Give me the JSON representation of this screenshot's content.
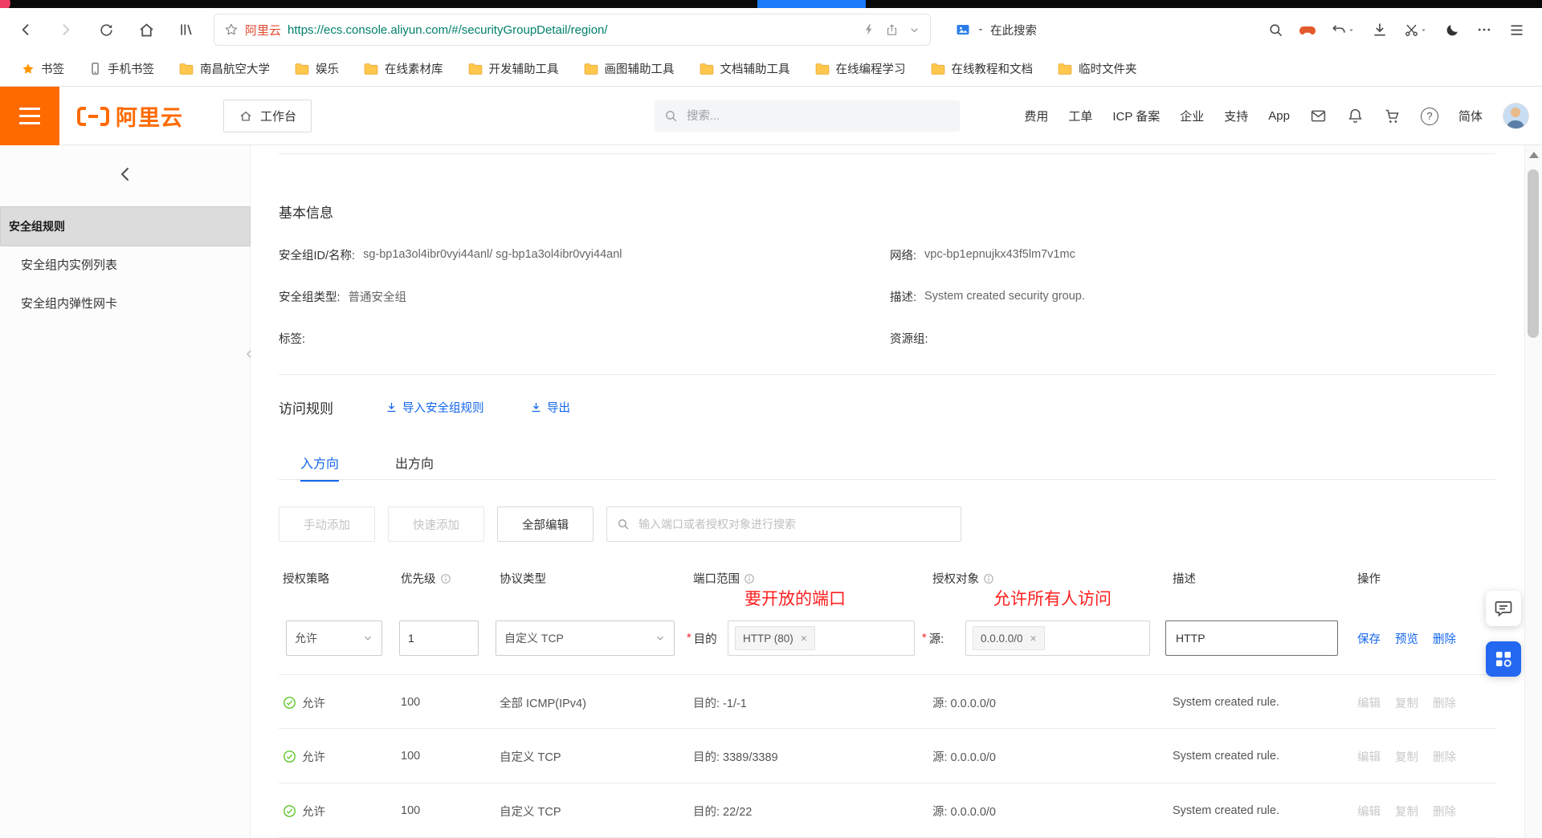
{
  "colors": {
    "brand_orange": "#ff6a00",
    "link_blue": "#1366ec",
    "url_teal": "#00806a",
    "annotation_red": "#ff1f1f",
    "success_green": "#52c41a",
    "float_button_blue": "#2468f2"
  },
  "browser": {
    "site_label": "阿里云",
    "url": "https://ecs.console.aliyun.com/#/securityGroupDetail/region/",
    "search_here": "在此搜索",
    "bookmarks": [
      {
        "label": "书签"
      },
      {
        "label": "手机书签"
      },
      {
        "label": "南昌航空大学"
      },
      {
        "label": "娱乐"
      },
      {
        "label": "在线素材库"
      },
      {
        "label": "开发辅助工具"
      },
      {
        "label": "画图辅助工具"
      },
      {
        "label": "文档辅助工具"
      },
      {
        "label": "在线编程学习"
      },
      {
        "label": "在线教程和文档"
      },
      {
        "label": "临时文件夹"
      }
    ]
  },
  "console": {
    "logo": "阿里云",
    "workbench": "工作台",
    "search_placeholder": "搜索...",
    "menu": [
      "费用",
      "工单",
      "ICP 备案",
      "企业",
      "支持",
      "App"
    ],
    "lang": "简体"
  },
  "sidebar": {
    "items": [
      "安全组规则",
      "安全组内实例列表",
      "安全组内弹性网卡"
    ]
  },
  "basic": {
    "title": "基本信息",
    "id_label": "安全组ID/名称:",
    "id_value": "sg-bp1a3ol4ibr0vyi44anl/ sg-bp1a3ol4ibr0vyi44anl",
    "network_label": "网络:",
    "network_value": "vpc-bp1epnujkx43f5lm7v1mc",
    "type_label": "安全组类型:",
    "type_value": "普通安全组",
    "desc_label": "描述:",
    "desc_value": "System created security group.",
    "tag_label": "标签:",
    "resource_label": "资源组:"
  },
  "rules": {
    "title": "访问规则",
    "import": "导入安全组规则",
    "export": "导出",
    "tab_in": "入方向",
    "tab_out": "出方向",
    "btn_manual": "手动添加",
    "btn_quick": "快速添加",
    "btn_edit_all": "全部编辑",
    "search_placeholder": "输入端口或者授权对象进行搜索",
    "headers": {
      "policy": "授权策略",
      "priority": "优先级",
      "protocol": "协议类型",
      "port": "端口范围",
      "target": "授权对象",
      "desc": "描述",
      "ops": "操作"
    },
    "annotation_port": "要开放的端口",
    "annotation_access": "允许所有人访问",
    "edit": {
      "required_mark": "*",
      "policy": "允许",
      "priority": "1",
      "protocol": "自定义 TCP",
      "dest_label": "目的",
      "port_chip": "HTTP (80)",
      "remove": "×",
      "src_label": "源:",
      "src_chip": "0.0.0.0/0",
      "desc_value": "HTTP",
      "save": "保存",
      "preview": "预览",
      "delete": "删除"
    },
    "rows": [
      {
        "policy": "允许",
        "priority": "100",
        "protocol": "全部 ICMP(IPv4)",
        "port": "目的: -1/-1",
        "source": "源: 0.0.0.0/0",
        "desc": "System created rule.",
        "op1": "编辑",
        "op2": "复制",
        "op3": "删除"
      },
      {
        "policy": "允许",
        "priority": "100",
        "protocol": "自定义 TCP",
        "port": "目的: 3389/3389",
        "source": "源: 0.0.0.0/0",
        "desc": "System created rule.",
        "op1": "编辑",
        "op2": "复制",
        "op3": "删除"
      },
      {
        "policy": "允许",
        "priority": "100",
        "protocol": "自定义 TCP",
        "port": "目的: 22/22",
        "source": "源: 0.0.0.0/0",
        "desc": "System created rule.",
        "op1": "编辑",
        "op2": "复制",
        "op3": "删除"
      }
    ]
  }
}
